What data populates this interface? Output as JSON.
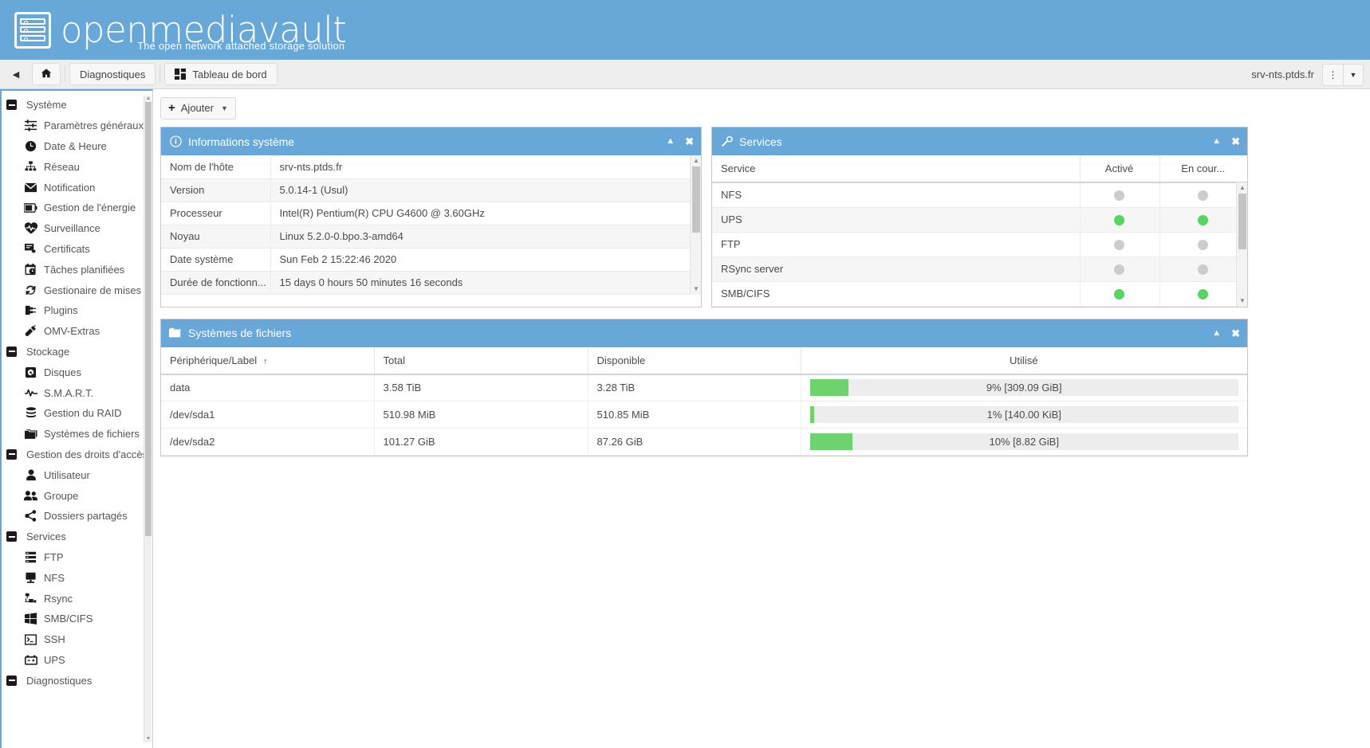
{
  "brand": {
    "name": "openmediavault",
    "tagline": "The open network attached storage solution",
    "logo_icon": "server-rack-icon"
  },
  "topbar": {
    "collapse_icon": "chevron-left-icon",
    "home_icon": "home-icon",
    "buttons": [
      {
        "label": "Diagnostiques",
        "icon": ""
      },
      {
        "label": "Tableau de bord",
        "icon": "dashboard-grid-icon"
      }
    ],
    "host_label": "srv-nts.ptds.fr",
    "menu_icon": "vertical-dots-icon",
    "dropdown_icon": "chevron-down-icon"
  },
  "content_toolbar": {
    "add_label": "Ajouter",
    "add_icon": "plus-icon",
    "caret_icon": "chevron-down-icon"
  },
  "sidebar": {
    "items": [
      {
        "label": "Système",
        "type": "group",
        "icon": "minus-box-icon"
      },
      {
        "label": "Paramètres généraux",
        "type": "child",
        "icon": "sliders-icon"
      },
      {
        "label": "Date & Heure",
        "type": "child",
        "icon": "clock-icon"
      },
      {
        "label": "Réseau",
        "type": "child",
        "icon": "network-icon"
      },
      {
        "label": "Notification",
        "type": "child",
        "icon": "envelope-icon"
      },
      {
        "label": "Gestion de l'énergie",
        "type": "child",
        "icon": "battery-icon"
      },
      {
        "label": "Surveillance",
        "type": "child",
        "icon": "heartbeat-icon"
      },
      {
        "label": "Certificats",
        "type": "child",
        "icon": "certificate-icon"
      },
      {
        "label": "Tâches planifiées",
        "type": "child",
        "icon": "calendar-clock-icon"
      },
      {
        "label": "Gestionaire de mises à",
        "type": "child",
        "icon": "refresh-icon"
      },
      {
        "label": "Plugins",
        "type": "child",
        "icon": "plugin-icon"
      },
      {
        "label": "OMV-Extras",
        "type": "child",
        "icon": "power-plug-icon"
      },
      {
        "label": "Stockage",
        "type": "group",
        "icon": "minus-box-icon"
      },
      {
        "label": "Disques",
        "type": "child",
        "icon": "hard-disk-icon"
      },
      {
        "label": "S.M.A.R.T.",
        "type": "child",
        "icon": "pulse-icon"
      },
      {
        "label": "Gestion du RAID",
        "type": "child",
        "icon": "database-stack-icon"
      },
      {
        "label": "Systèmes de fichiers",
        "type": "child",
        "icon": "folder-icon"
      },
      {
        "label": "Gestion des droits d'accès",
        "type": "group",
        "icon": "minus-box-icon"
      },
      {
        "label": "Utilisateur",
        "type": "child",
        "icon": "user-icon"
      },
      {
        "label": "Groupe",
        "type": "child",
        "icon": "users-icon"
      },
      {
        "label": "Dossiers partagés",
        "type": "child",
        "icon": "share-icon"
      },
      {
        "label": "Services",
        "type": "group",
        "icon": "minus-box-icon"
      },
      {
        "label": "FTP",
        "type": "child",
        "icon": "server-icon"
      },
      {
        "label": "NFS",
        "type": "child",
        "icon": "monitor-icon"
      },
      {
        "label": "Rsync",
        "type": "child",
        "icon": "sync-nodes-icon"
      },
      {
        "label": "SMB/CIFS",
        "type": "child",
        "icon": "windows-icon"
      },
      {
        "label": "SSH",
        "type": "child",
        "icon": "terminal-icon"
      },
      {
        "label": "UPS",
        "type": "child",
        "icon": "ups-battery-icon"
      },
      {
        "label": "Diagnostiques",
        "type": "group",
        "icon": "minus-box-icon"
      }
    ]
  },
  "panels": {
    "system_info": {
      "title": "Informations système",
      "icon": "info-circle-icon",
      "collapse_icon": "triangle-up-icon",
      "close_icon": "close-x-icon",
      "rows": [
        {
          "key": "Nom de l'hôte",
          "value": "srv-nts.ptds.fr"
        },
        {
          "key": "Version",
          "value": "5.0.14-1 (Usul)"
        },
        {
          "key": "Processeur",
          "value": "Intel(R) Pentium(R) CPU G4600 @ 3.60GHz"
        },
        {
          "key": "Noyau",
          "value": "Linux 5.2.0-0.bpo.3-amd64"
        },
        {
          "key": "Date système",
          "value": "Sun Feb 2 15:22:46 2020"
        },
        {
          "key": "Durée de fonctionn...",
          "value": "15 days 0 hours 50 minutes 16 seconds"
        }
      ]
    },
    "services": {
      "title": "Services",
      "icon": "wrench-icon",
      "collapse_icon": "triangle-up-icon",
      "close_icon": "close-x-icon",
      "columns": [
        "Service",
        "Activé",
        "En cour..."
      ],
      "rows": [
        {
          "service": "NFS",
          "enabled": false,
          "running": false
        },
        {
          "service": "UPS",
          "enabled": true,
          "running": true
        },
        {
          "service": "FTP",
          "enabled": false,
          "running": false
        },
        {
          "service": "RSync server",
          "enabled": false,
          "running": false
        },
        {
          "service": "SMB/CIFS",
          "enabled": true,
          "running": true
        }
      ]
    },
    "filesystems": {
      "title": "Systèmes de fichiers",
      "icon": "folder-icon",
      "collapse_icon": "triangle-up-icon",
      "close_icon": "close-x-icon",
      "columns": [
        "Périphérique/Label",
        "Total",
        "Disponible",
        "Utilisé"
      ],
      "sort_indicator": "↑",
      "rows": [
        {
          "device": "data",
          "total": "3.58 TiB",
          "available": "3.28 TiB",
          "used_pct": 9,
          "used_text": "9% [309.09 GiB]"
        },
        {
          "device": "/dev/sda1",
          "total": "510.98 MiB",
          "available": "510.85 MiB",
          "used_pct": 1,
          "used_text": "1% [140.00 KiB]"
        },
        {
          "device": "/dev/sda2",
          "total": "101.27 GiB",
          "available": "87.26 GiB",
          "used_pct": 10,
          "used_text": "10% [8.82 GiB]"
        }
      ]
    }
  },
  "colors": {
    "brand_blue": "#68a8d8",
    "status_on": "#53d761",
    "status_off": "#cccccc",
    "bar_green": "#6dd36d"
  }
}
